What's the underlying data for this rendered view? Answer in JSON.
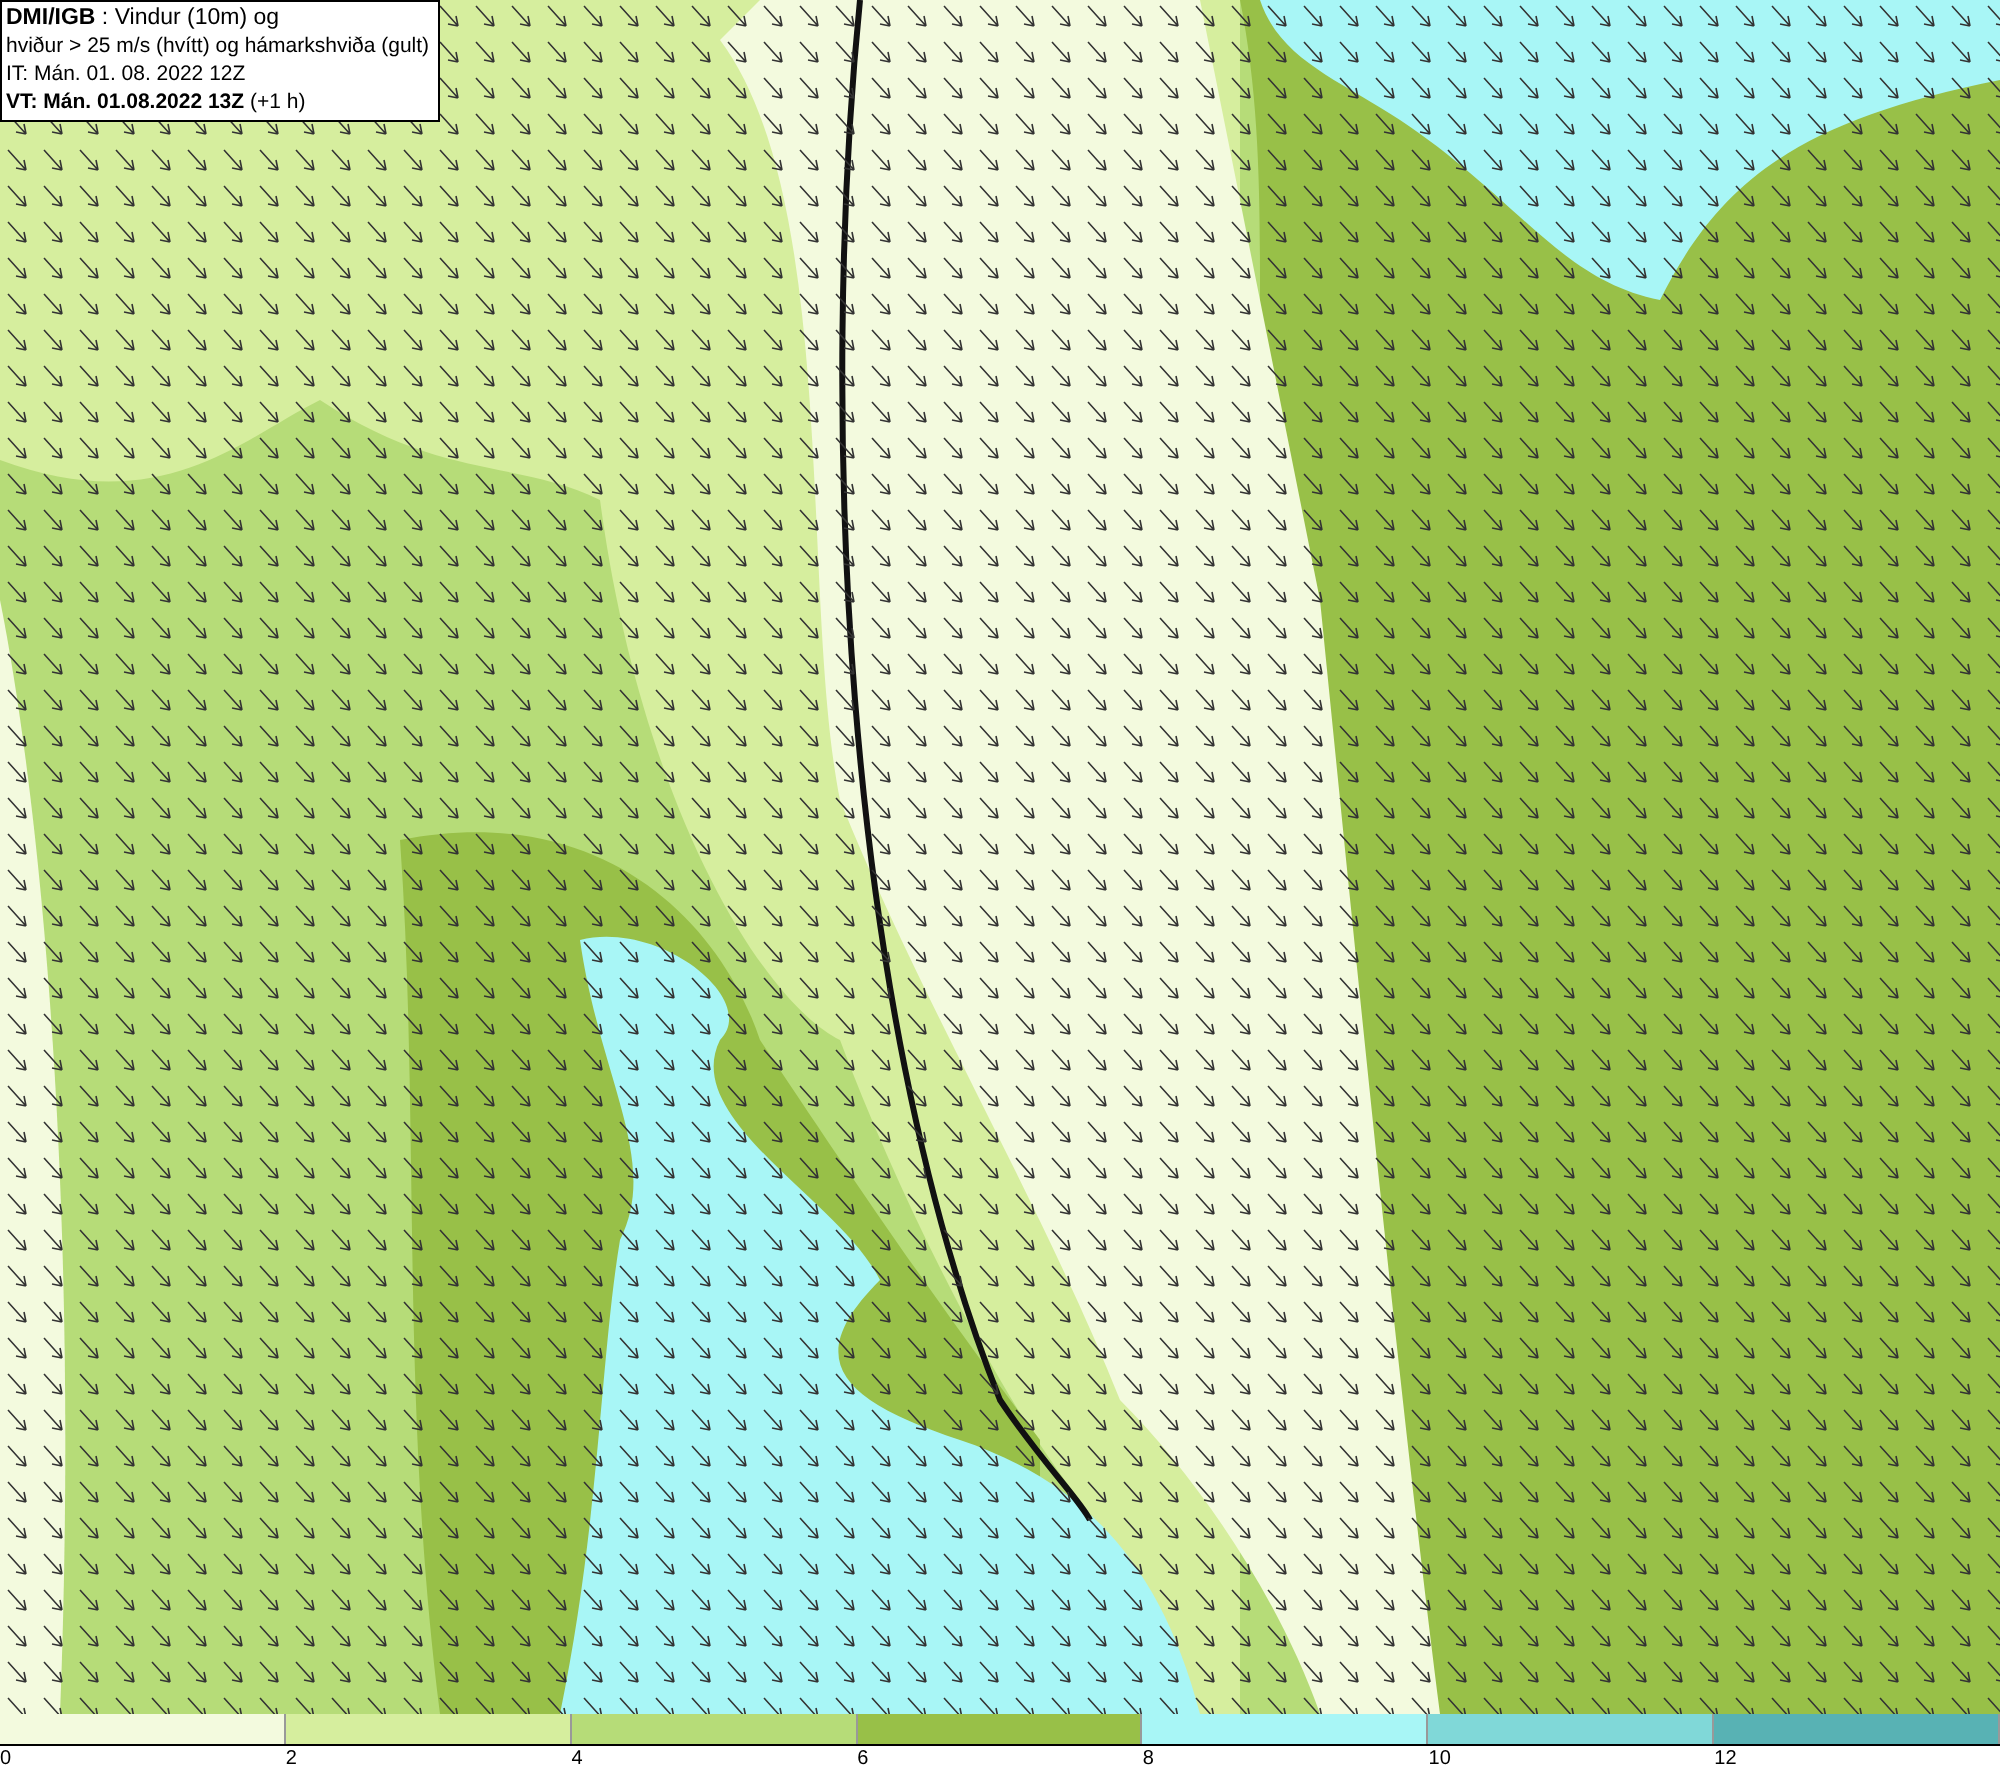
{
  "title_box": {
    "lines": [
      "**DMI/IGB** : Vindur (10m) og",
      "hviður > 25 m/s (hvítt) og hámarkshviða (gult)",
      "IT: Mán. 01. 08. 2022 12Z",
      "**VT: Mán. 01.08.2022 13Z** (+1 h)"
    ]
  },
  "legend": {
    "segments": [
      {
        "label": "0",
        "color": "#f3fade"
      },
      {
        "label": "2",
        "color": "#d6ee9e"
      },
      {
        "label": "4",
        "color": "#b6dc78"
      },
      {
        "label": "6",
        "color": "#98c048"
      },
      {
        "label": "8",
        "color": "#a8f6f6"
      },
      {
        "label": "10",
        "color": "#80d8d8"
      },
      {
        "label": "12",
        "color": "#58b2b4"
      }
    ]
  }
}
